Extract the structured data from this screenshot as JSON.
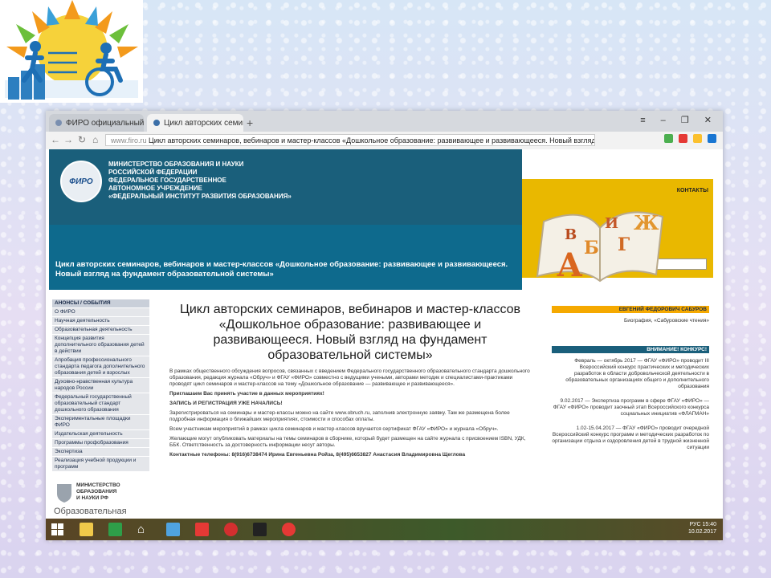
{
  "browser": {
    "tabs": [
      {
        "label": "ФИРО официальный сайт"
      },
      {
        "label": "Цикл авторских семинар"
      }
    ],
    "new_tab": "+",
    "url_domain": "www.firo.ru",
    "url_text": "Цикл авторских семинаров, вебинаров и мастер-классов «Дошкольное образование: развивающее и развивающееся. Новый взгляд на фундаме"
  },
  "header": {
    "emblem_text": "ФИРО",
    "ministry_lines": [
      "МИНИСТЕРСТВО ОБРАЗОВАНИЯ И НАУКИ",
      "РОССИЙСКОЙ ФЕДЕРАЦИИ",
      "ФЕДЕРАЛЬНОЕ ГОСУДАРСТВЕННОЕ",
      "АВТОНОМНОЕ  УЧРЕЖДЕНИЕ",
      "«ФЕДЕРАЛЬНЫЙ ИНСТИТУТ РАЗВИТИЯ ОБРАЗОВАНИЯ»"
    ],
    "banner_title": "Цикл авторских семинаров, вебинаров и мастер-классов «Дошкольное образование: развивающее и развивающееся. Новый взгляд на фундамент образовательной системы»",
    "contacts": "КОНТАКТЫ",
    "book_letters": [
      "А",
      "Б",
      "В",
      "Г",
      "Ж",
      "И"
    ]
  },
  "sidebar": {
    "items": [
      {
        "label": "АНОНСЫ / СОБЫТИЯ",
        "header": true
      },
      {
        "label": "О ФИРО"
      },
      {
        "label": "Научная деятельность"
      },
      {
        "label": "Образовательная деятельность"
      },
      {
        "label": "Концепция развития дополнительного образования детей в действии"
      },
      {
        "label": "Апробация профессионального стандарта педагога дополнительного образования детей и взрослых"
      },
      {
        "label": "Духовно-нравственная культура народов России"
      },
      {
        "label": "Федеральный государственный образовательный стандарт дошкольного образования"
      },
      {
        "label": "Экспериментальные площадки ФИРО"
      },
      {
        "label": "Издательская деятельность"
      },
      {
        "label": "Программы профобразования"
      },
      {
        "label": "Экспертиза"
      },
      {
        "label": "Реализация учебной продукции и программ"
      }
    ],
    "ministry_logo_lines": [
      "МИНИСТЕРСТВО",
      "ОБРАЗОВАНИЯ",
      "И НАУКИ РФ"
    ],
    "bottom_text": "Образовательная"
  },
  "main": {
    "title": "Цикл авторских семинаров, вебинаров и мастер-классов «Дошкольное образование: развивающее и развивающееся. Новый взгляд на фундамент образовательной системы»",
    "paragraphs": [
      {
        "text": "В рамках общественного обсуждения вопросов, связанных с введением Федерального государственного образовательного стандарта дошкольного образования, редакция журнала «Обруч» и ФГАУ «ФИРО» совместно с ведущими учеными, авторами методик и специалистами-практиками проводят цикл семинаров и мастер-классов на тему «Дошкольное образование — развивающее и развивающееся».",
        "bold": false
      },
      {
        "text": "Приглашаем Вас принять участие в данных мероприятиях!",
        "bold": true
      },
      {
        "text": "ЗАПИСЬ И РЕГИСТРАЦИЯ УЖЕ НАЧАЛИСЬ!",
        "bold": true
      },
      {
        "text": "Зарегистрироваться на семинары и мастер-классы можно на сайте www.obruch.ru, заполнив электронную заявку. Там же размещена более подробная информация о ближайших мероприятиях, стоимости и способах оплаты.",
        "bold": false
      },
      {
        "text": "Всем участникам мероприятий в рамках цикла семинаров и мастер-классов вручается сертификат ФГАУ «ФИРО» и журнала «Обруч».",
        "bold": false
      },
      {
        "text": "Желающие могут опубликовать материалы на темы семинаров в сборнике, который будет размещен на сайте журнала с присвоением ISBN, УДК, ББК. Ответственность за достоверность информации несут авторы.",
        "bold": false
      },
      {
        "text": "Контактные телефоны: 8(916)6738474 Ирина Евгеньевна Ройза, 8(495)6653827 Анастасия Владимировна Щеглова",
        "bold": true
      }
    ]
  },
  "right": {
    "header1": "ЕВГЕНИЙ ФЕДОРОВИЧ САБУРОВ",
    "link1": "Биография, «Сабуровские чтения»",
    "header2": "ВНИМАНИЕ! КОНКУРС!",
    "news": [
      {
        "text": "Февраль — октябрь 2017 — ФГАУ «ФИРО» проводит III Всероссийский конкурс практических и методических разработок в области добровольческой деятельности в образовательных организациях общего и дополнительного образования"
      },
      {
        "text": "9.02.2017 — Экспертиза программ в сфере ФГАУ «ФИРО» — ФГАУ «ФИРО» проводит заочный этап Всероссийского конкурса социальных инициатив «ФЛАГМАН»"
      },
      {
        "text": "1.02-15.04.2017 — ФГАУ «ФИРО» проводит очередной Всероссийский конкурс программ и методических разработок по организации отдыха и оздоровления детей в трудной жизненной ситуации"
      }
    ]
  },
  "taskbar": {
    "lang": "РУС",
    "time": "15:40",
    "date": "10.02.2017"
  },
  "colors": {
    "banner_blue": "#0e6a8d",
    "accent_yellow": "#e9b800",
    "orange_header": "#f5a900"
  }
}
